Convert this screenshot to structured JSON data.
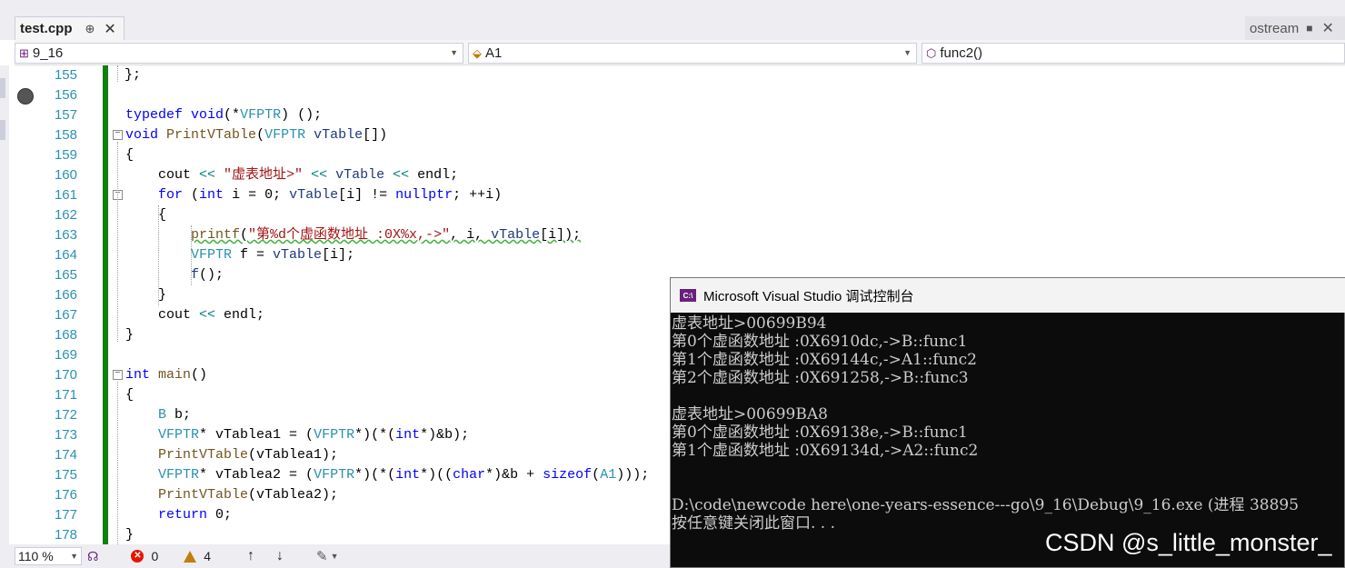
{
  "tabs": {
    "active": {
      "label": "test.cpp",
      "pin": "⊕",
      "close": "✕"
    },
    "right": {
      "label": "ostream",
      "pin": "■",
      "close": "✕"
    }
  },
  "nav": {
    "project": "9_16",
    "scope": "A1",
    "member": "func2()"
  },
  "code": {
    "lines": [
      {
        "n": "155"
      },
      {
        "n": "156"
      },
      {
        "n": "157"
      },
      {
        "n": "158"
      },
      {
        "n": "159"
      },
      {
        "n": "160"
      },
      {
        "n": "161"
      },
      {
        "n": "162"
      },
      {
        "n": "163"
      },
      {
        "n": "164"
      },
      {
        "n": "165"
      },
      {
        "n": "166"
      },
      {
        "n": "167"
      },
      {
        "n": "168"
      },
      {
        "n": "169"
      },
      {
        "n": "170"
      },
      {
        "n": "171"
      },
      {
        "n": "172"
      },
      {
        "n": "173"
      },
      {
        "n": "174"
      },
      {
        "n": "175"
      },
      {
        "n": "176"
      },
      {
        "n": "177"
      },
      {
        "n": "178"
      }
    ],
    "src": {
      "l155": "};",
      "l157a": "typedef",
      "l157b": " ",
      "l157c": "void",
      "l157d": "(*",
      "l157e": "VFPTR",
      "l157f": ") ();",
      "l158a": "void",
      "l158b": " ",
      "l158c": "PrintVTable",
      "l158d": "(",
      "l158e": "VFPTR",
      "l158f": " ",
      "l158g": "vTable",
      "l158h": "[])",
      "l159": "{",
      "l160a": "    cout ",
      "l160b": "<<",
      "l160c": " ",
      "l160d": "\"虚表地址>\"",
      "l160e": " ",
      "l160f": "<<",
      "l160g": " vTable ",
      "l160h": "<<",
      "l160i": " endl;",
      "l161a": "    ",
      "l161b": "for",
      "l161c": " (",
      "l161d": "int",
      "l161e": " i = 0; ",
      "l161f": "vTable",
      "l161g": "[i] != ",
      "l161h": "nullptr",
      "l161i": "; ++i)",
      "l162": "    {",
      "l163a": "        ",
      "l163b": "printf",
      "l163c": "(",
      "l163d": "\"第%d个虚函数地址 :0X%x,->\"",
      "l163e": ", i, ",
      "l163f": "vTable",
      "l163g": "[i]);",
      "l164a": "        ",
      "l164b": "VFPTR",
      "l164c": " f = ",
      "l164d": "vTable",
      "l164e": "[i];",
      "l165a": "        ",
      "l165b": "f",
      "l165c": "();",
      "l166": "    }",
      "l167a": "    cout ",
      "l167b": "<<",
      "l167c": " endl;",
      "l168": "}",
      "l170a": "int",
      "l170b": " ",
      "l170c": "main",
      "l170d": "()",
      "l171": "{",
      "l172a": "    ",
      "l172b": "B",
      "l172c": " b;",
      "l173a": "    ",
      "l173b": "VFPTR",
      "l173c": "* vTablea1 = (",
      "l173d": "VFPTR",
      "l173e": "*)(*(",
      "l173f": "int",
      "l173g": "*)&b);",
      "l174a": "    ",
      "l174b": "PrintVTable",
      "l174c": "(vTablea1);",
      "l175a": "    ",
      "l175b": "VFPTR",
      "l175c": "* vTablea2 = (",
      "l175d": "VFPTR",
      "l175e": "*)(*(",
      "l175f": "int",
      "l175g": "*)((",
      "l175h": "char",
      "l175i": "*)&b + ",
      "l175j": "sizeof",
      "l175k": "(",
      "l175l": "A1",
      "l175m": ")));",
      "l176a": "    ",
      "l176b": "PrintVTable",
      "l176c": "(vTablea2);",
      "l177a": "    ",
      "l177b": "return",
      "l177c": " 0;",
      "l178": "}"
    }
  },
  "console": {
    "title": "Microsoft Visual Studio 调试控制台",
    "icon_label": "C:\\",
    "lines": [
      "虚表地址>00699B94",
      "第0个虚函数地址 :0X6910dc,->B::func1",
      "第1个虚函数地址 :0X69144c,->A1::func2",
      "第2个虚函数地址 :0X691258,->B::func3",
      "",
      "虚表地址>00699BA8",
      "第0个虚函数地址 :0X69138e,->B::func1",
      "第1个虚函数地址 :0X69134d,->A2::func2",
      "",
      "",
      "D:\\code\\newcode here\\one-years-essence---go\\9_16\\Debug\\9_16.exe (进程 38895",
      "按任意键关闭此窗口. . ."
    ]
  },
  "status": {
    "zoom": "110 %",
    "errors": "0",
    "warnings": "4",
    "up": "↑",
    "down": "↓",
    "brush": "✎"
  },
  "watermark": "CSDN @s_little_monster_",
  "colors": {
    "keyword": "#0000ff",
    "type": "#2b91af",
    "string": "#a31515",
    "changebar": "#108010",
    "console_bg": "#0c0c0c"
  }
}
